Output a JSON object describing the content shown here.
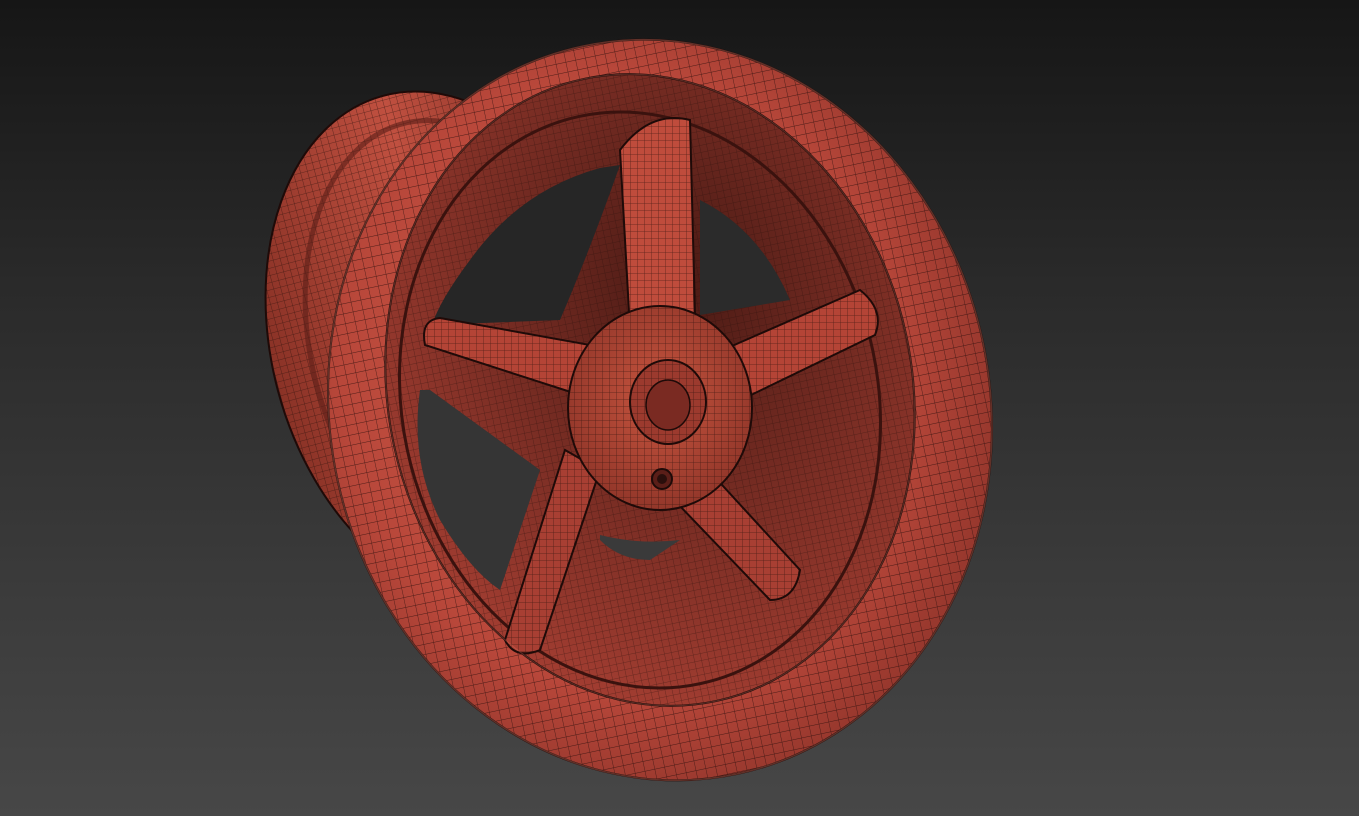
{
  "viewport": {
    "background_top": "#161616",
    "background_bottom": "#474747"
  },
  "model": {
    "object": "wheel-rim",
    "spoke_count": 5,
    "material_color": "#b8473a",
    "shadow_color": "#7a2a22",
    "highlight_color": "#d86a58",
    "wireframe_color": "#2a0f0c"
  }
}
